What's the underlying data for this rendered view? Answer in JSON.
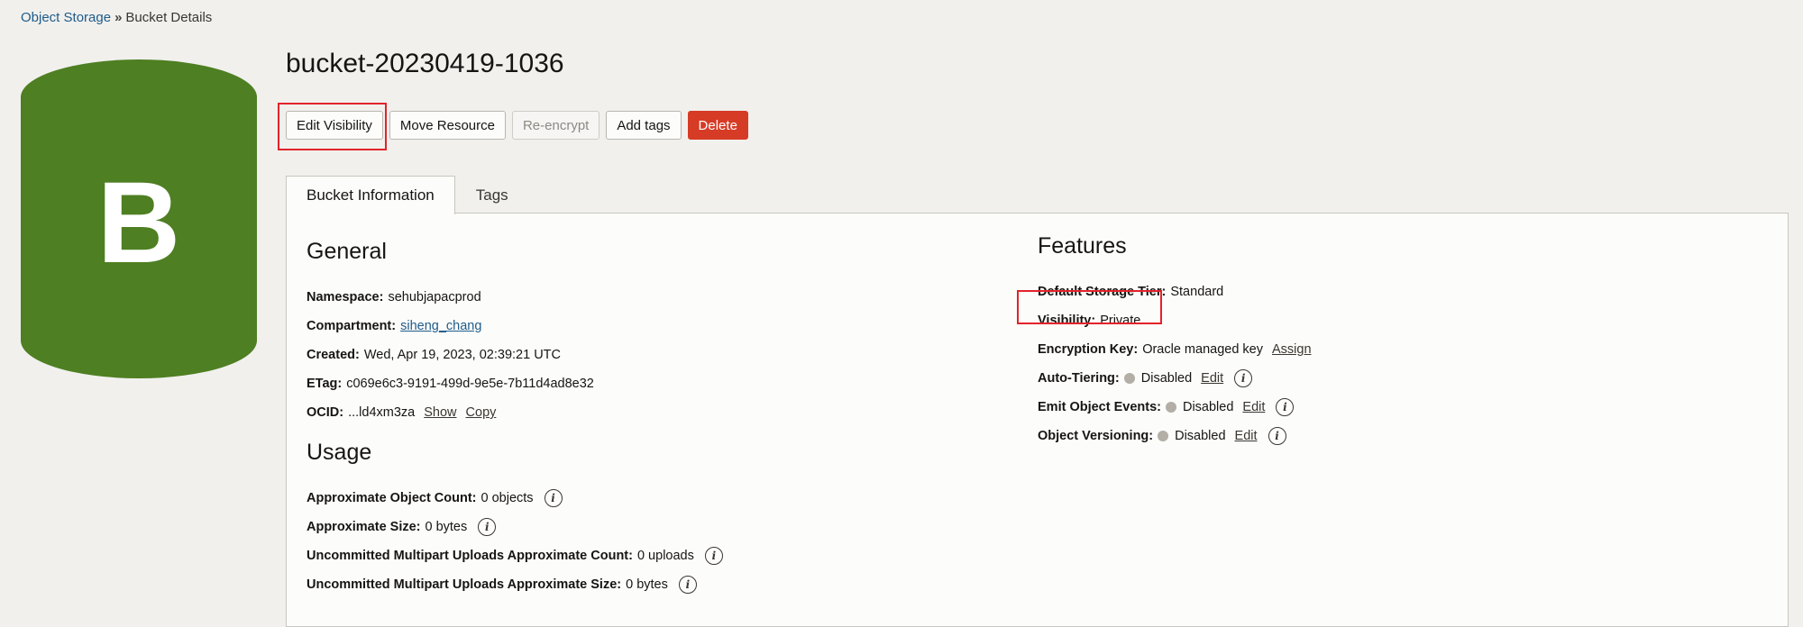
{
  "breadcrumb": {
    "parent": "Object Storage",
    "separator": "»",
    "current": "Bucket Details"
  },
  "bucket": {
    "letter": "B",
    "name": "bucket-20230419-1036",
    "icon_color": "#4e7f22"
  },
  "actions": {
    "edit_visibility": "Edit Visibility",
    "move_resource": "Move Resource",
    "reencrypt": "Re-encrypt",
    "add_tags": "Add tags",
    "delete": "Delete"
  },
  "tabs": [
    {
      "label": "Bucket Information"
    },
    {
      "label": "Tags"
    }
  ],
  "general": {
    "title": "General",
    "namespace": {
      "label": "Namespace:",
      "value": "sehubjapacprod"
    },
    "compartment": {
      "label": "Compartment:",
      "value": "siheng_chang"
    },
    "created": {
      "label": "Created:",
      "value": "Wed, Apr 19, 2023, 02:39:21 UTC"
    },
    "etag": {
      "label": "ETag:",
      "value": "c069e6c3-9191-499d-9e5e-7b11d4ad8e32"
    },
    "ocid": {
      "label": "OCID:",
      "value": "...ld4xm3za",
      "show": "Show",
      "copy": "Copy"
    }
  },
  "usage": {
    "title": "Usage",
    "object_count": {
      "label": "Approximate Object Count:",
      "value": "0 objects"
    },
    "size": {
      "label": "Approximate Size:",
      "value": "0 bytes"
    },
    "multipart_count": {
      "label": "Uncommitted Multipart Uploads Approximate Count:",
      "value": "0 uploads"
    },
    "multipart_size": {
      "label": "Uncommitted Multipart Uploads Approximate Size:",
      "value": "0 bytes"
    }
  },
  "features": {
    "title": "Features",
    "storage_tier": {
      "label": "Default Storage Tier:",
      "value": "Standard"
    },
    "visibility": {
      "label": "Visibility:",
      "value": "Private"
    },
    "encryption": {
      "label": "Encryption Key:",
      "value": "Oracle managed key",
      "action": "Assign"
    },
    "auto_tiering": {
      "label": "Auto-Tiering:",
      "value": "Disabled",
      "action": "Edit"
    },
    "emit_events": {
      "label": "Emit Object Events:",
      "value": "Disabled",
      "action": "Edit"
    },
    "versioning": {
      "label": "Object Versioning:",
      "value": "Disabled",
      "action": "Edit"
    }
  },
  "colors": {
    "highlight": "#e2232a",
    "delete": "#d63b25",
    "status_dot": "#b3aea6"
  }
}
